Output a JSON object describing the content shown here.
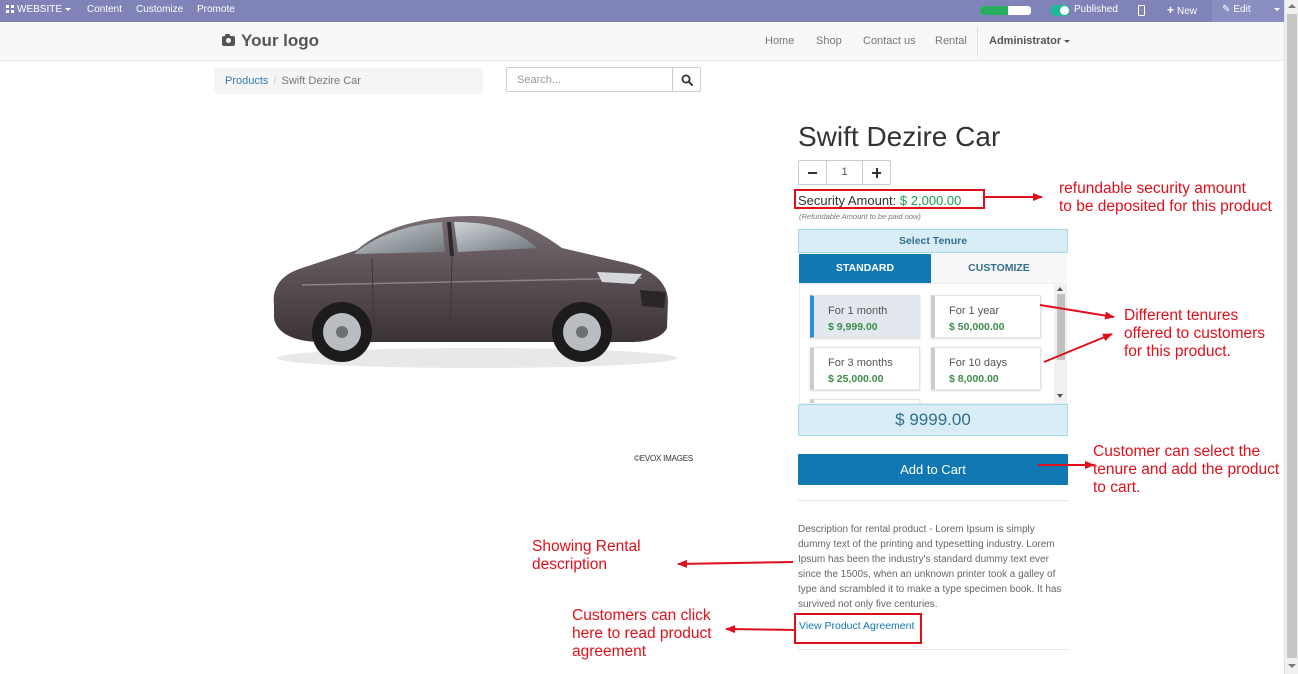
{
  "adminbar": {
    "website_label": "WEBSITE",
    "content_label": "Content",
    "customize_label": "Customize",
    "promote_label": "Promote",
    "progress": 0.55,
    "published_label": "Published",
    "new_label": "New",
    "edit_label": "Edit"
  },
  "navbar": {
    "logo_text": "Your logo",
    "links": [
      "Home",
      "Shop",
      "Contact us",
      "Rental"
    ],
    "user_label": "Administrator"
  },
  "breadcrumb": {
    "parent": "Products",
    "current": "Swift Dezire Car"
  },
  "search": {
    "placeholder": "Search..."
  },
  "image": {
    "watermark": "©EVOX IMAGES"
  },
  "product": {
    "title": "Swift Dezire Car",
    "quantity": "1",
    "security_label": "Security Amount:",
    "security_amount": "$ 2,000.00",
    "security_note": "(Refundable Amount to be paid now)",
    "add_to_cart_label": "Add to Cart",
    "description": "Description for rental product - Lorem Ipsum is simply dummy text of the printing and typesetting industry. Lorem Ipsum has been the industry's standard dummy text ever since the 1500s, when an unknown printer took a galley of type and scrambled it to make a type specimen book. It has survived not only five centuries.",
    "agreement_link": "View Product Agreement"
  },
  "tenure": {
    "header": "Select Tenure",
    "tabs": [
      "STANDARD",
      "CUSTOMIZE"
    ],
    "active_tab": "STANDARD",
    "options": [
      {
        "label": "For 1 month",
        "price": "$ 9,999.00",
        "selected": true
      },
      {
        "label": "For 1 year",
        "price": "$ 50,000.00",
        "selected": false
      },
      {
        "label": "For 3 months",
        "price": "$ 25,000.00",
        "selected": false
      },
      {
        "label": "For 10 days",
        "price": "$ 8,000.00",
        "selected": false
      }
    ],
    "total": "$ 9999.00"
  },
  "annotations": {
    "security": [
      "refundable security amount",
      "to be deposited for this product"
    ],
    "tenures": [
      "Different tenures",
      "offered to customers",
      "for this product."
    ],
    "cart": [
      "Customer can select the",
      "tenure and add the product",
      "to cart."
    ],
    "description": [
      "Showing Rental",
      "description"
    ],
    "agreement": [
      "Customers can click",
      "here to read product",
      "agreement"
    ]
  },
  "colors": {
    "adminbar": "#7f83b8",
    "primary": "#1178b3",
    "success_green": "#1a9e52",
    "annotation_red": "#e0101b",
    "info_bg": "#d9edf7"
  }
}
